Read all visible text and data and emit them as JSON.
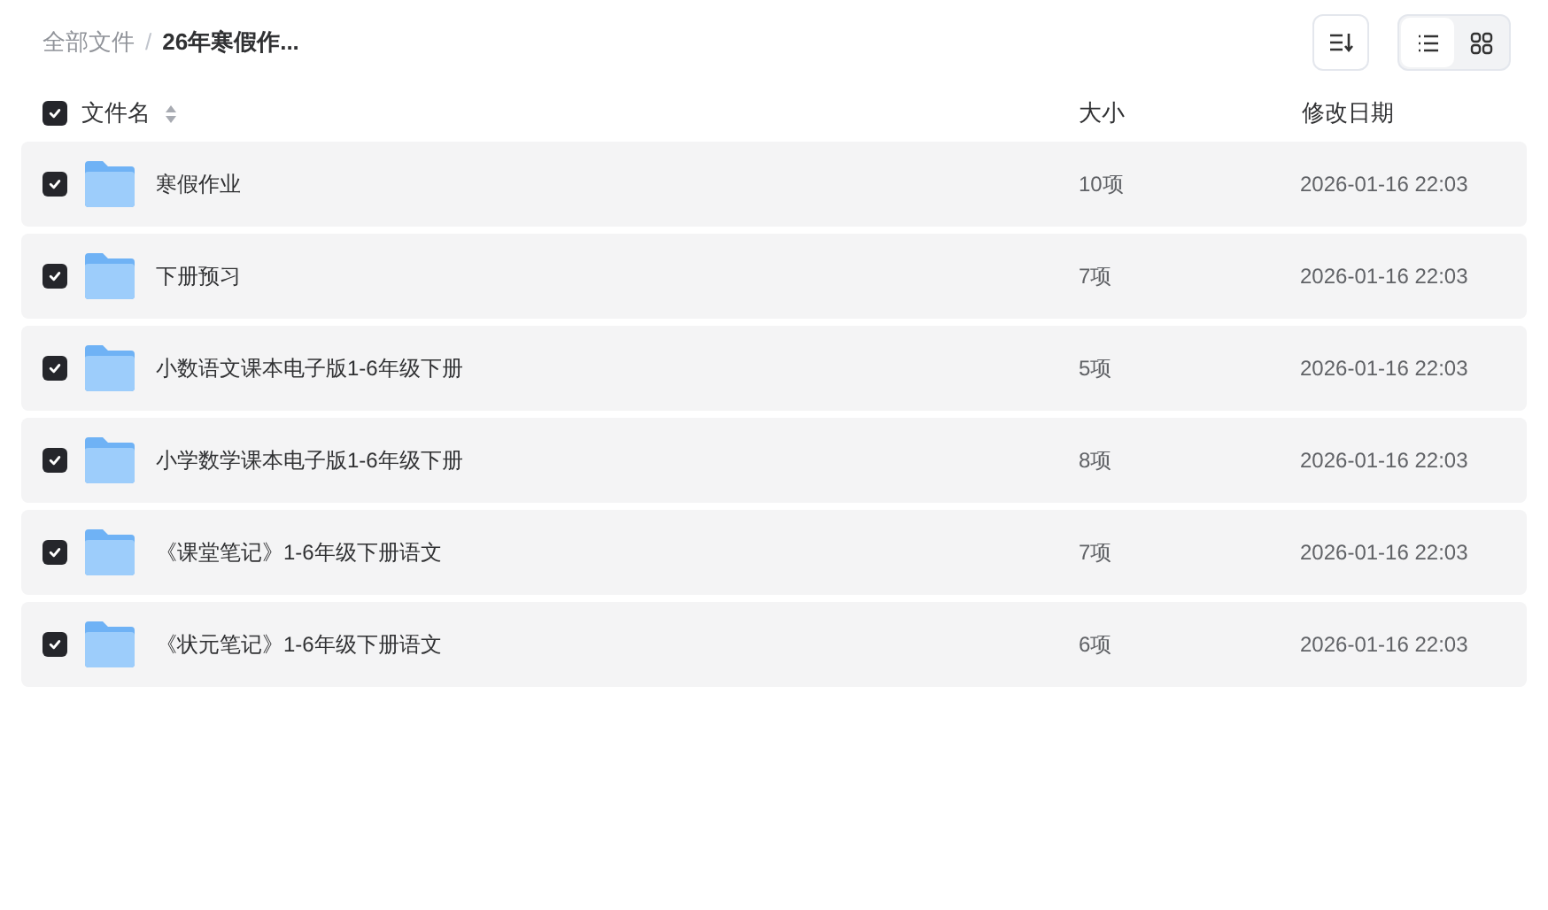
{
  "breadcrumb": [
    {
      "label": "全部文件",
      "current": false
    },
    {
      "separator": "/",
      "label": "26年寒假作...",
      "current": true
    }
  ],
  "view_modes": [
    {
      "kind": "list",
      "selected": true
    },
    {
      "kind": "grid",
      "selected": false
    }
  ],
  "header": {
    "checked": true,
    "columns": [
      "文件名",
      "大小",
      "修改日期"
    ]
  },
  "rows": [
    {
      "name": "寒假作业",
      "size": "10项",
      "modified": "2026-01-16 22:03",
      "checked": true
    },
    {
      "name": "下册预习",
      "size": "7项",
      "modified": "2026-01-16 22:03",
      "checked": true
    },
    {
      "name": "小数语文课本电子版1-6年级下册",
      "size": "5项",
      "modified": "2026-01-16 22:03",
      "checked": true
    },
    {
      "name": "小学数学课本电子版1-6年级下册",
      "size": "8项",
      "modified": "2026-01-16 22:03",
      "checked": true
    },
    {
      "name": "《课堂笔记》1-6年级下册语文",
      "size": "7项",
      "modified": "2026-01-16 22:03",
      "checked": true
    },
    {
      "name": "《状元笔记》1-6年级下册语文",
      "size": "6项",
      "modified": "2026-01-16 22:03",
      "checked": true
    }
  ]
}
